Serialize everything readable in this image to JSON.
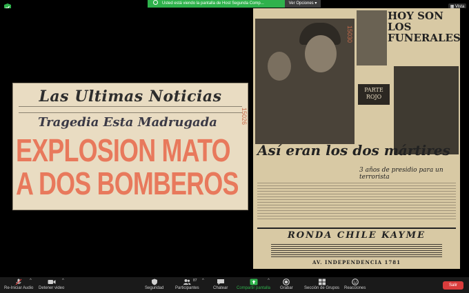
{
  "share_banner": {
    "text": "Usted está viendo la pantalla de Host Segunda Comp..."
  },
  "options_label": "Ver Opciones",
  "view_label": "Vista",
  "clipping": {
    "masthead": "Las Ultimas Noticias",
    "subhead": "Tragedia Esta Madrugada",
    "headline_line1": "EXPLOSION MATO",
    "headline_line2": "A DOS BOMBEROS",
    "stamp": "15026"
  },
  "newspaper": {
    "funerales": "HOY SON LOS FUNERALES",
    "parte_rojo": "PARTE ROJO",
    "asi_eran": "Así eran los dos mártires",
    "presidio": "3 años de presidio para un terrorista",
    "stamp": "15030",
    "ad_title": "RONDA CHILE KAYME",
    "ad_address": "AV. INDEPENDENCIA 1781"
  },
  "toolbar": {
    "audio": "Re-Iniciar Audio",
    "video": "Detener video",
    "security": "Seguridad",
    "participants": "Participantes",
    "participants_count": "87",
    "chat": "Chatear",
    "share": "Compartir pantalla",
    "record": "Grabar",
    "breakout": "Sección de Grupos",
    "reactions": "Reacciones",
    "leave": "Salir"
  },
  "colors": {
    "share_green": "#2fb24c",
    "leave_red": "#d93c3c",
    "headline_red": "#e8795c"
  }
}
